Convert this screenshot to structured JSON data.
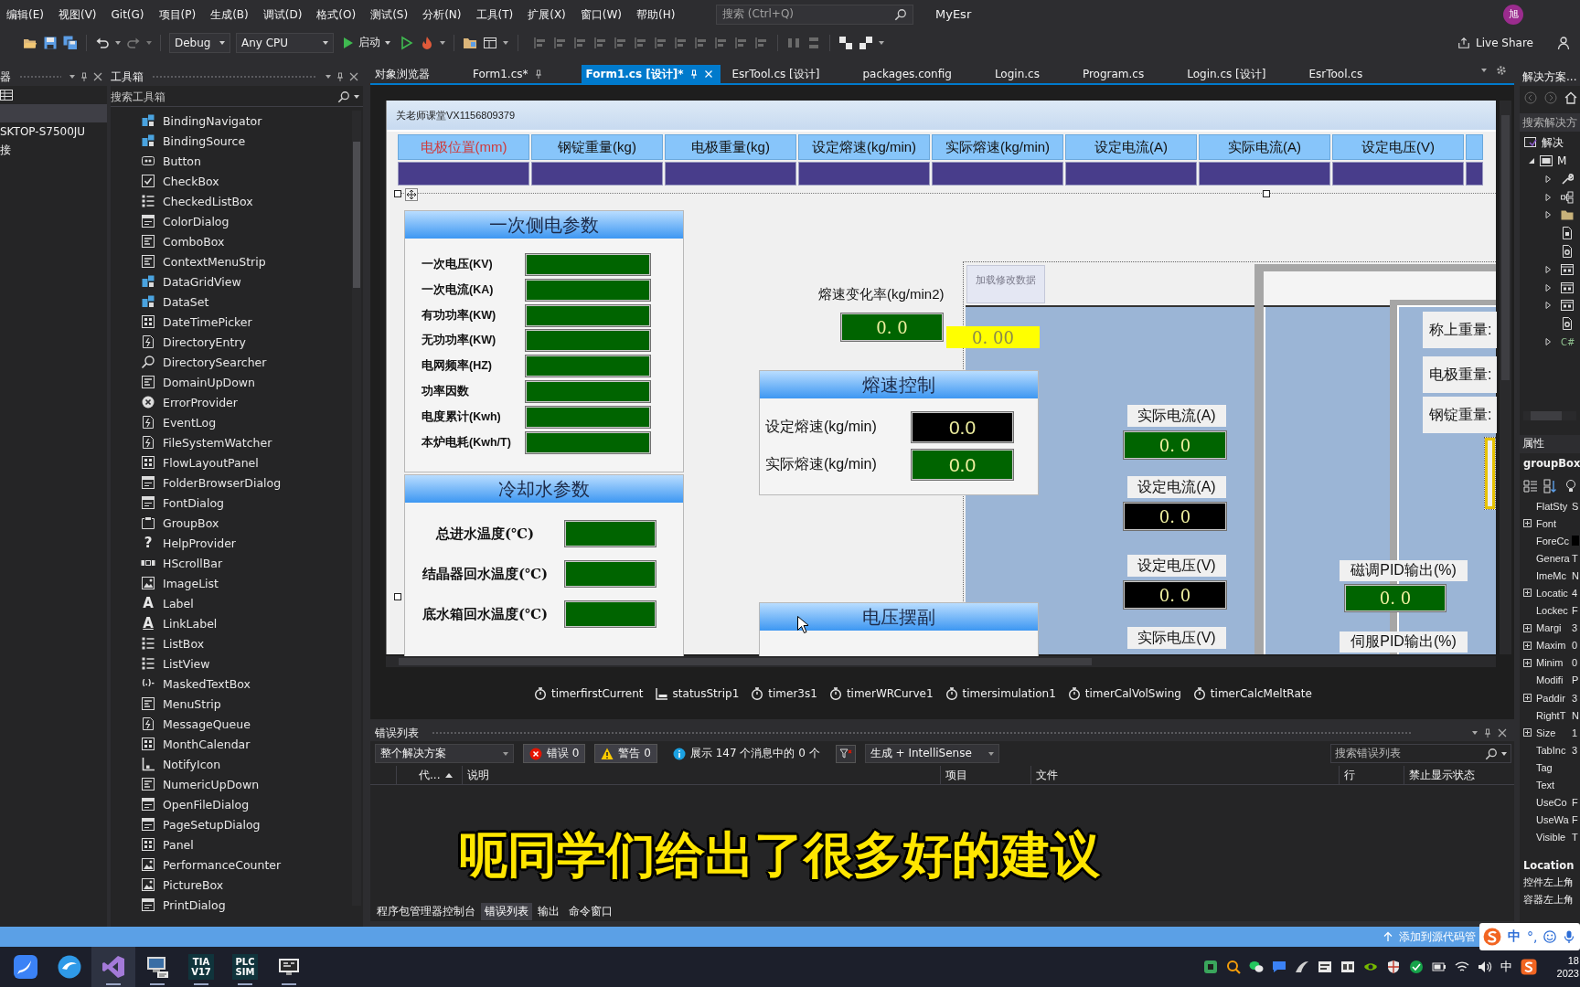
{
  "menu_bar": {
    "items": [
      "编辑(E)",
      "视图(V)",
      "Git(G)",
      "项目(P)",
      "生成(B)",
      "调试(D)",
      "格式(O)",
      "测试(S)",
      "分析(N)",
      "工具(T)",
      "扩展(X)",
      "窗口(W)",
      "帮助(H)"
    ],
    "search": {
      "placeholder": "搜索 (Ctrl+Q)"
    },
    "solution_name": "MyEsr",
    "account_initial": "旭"
  },
  "toolbar": {
    "configuration": "Debug",
    "platform": "Any CPU",
    "start": "启动",
    "live_share": "Live Share"
  },
  "server_explorer": {
    "title": "器",
    "items": [
      {
        "kind": "icon",
        "selected": false
      },
      {
        "kind": "blank",
        "selected": true
      },
      {
        "kind": "text",
        "text": "SKTOP-S7500JU",
        "selected": false
      },
      {
        "kind": "text",
        "text": "接",
        "selected": false
      }
    ]
  },
  "toolbox": {
    "title": "工具箱",
    "search": {
      "placeholder": "搜索工具箱"
    },
    "items": [
      {
        "name": "BindingNavigator",
        "kind": "data"
      },
      {
        "name": "BindingSource",
        "kind": "data"
      },
      {
        "name": "Button",
        "kind": "button"
      },
      {
        "name": "CheckBox",
        "kind": "check"
      },
      {
        "name": "CheckedListBox",
        "kind": "list"
      },
      {
        "name": "ColorDialog",
        "kind": "dialog"
      },
      {
        "name": "ComboBox",
        "kind": "combo"
      },
      {
        "name": "ContextMenuStrip",
        "kind": "combo"
      },
      {
        "name": "DataGridView",
        "kind": "data"
      },
      {
        "name": "DataSet",
        "kind": "data"
      },
      {
        "name": "DateTimePicker",
        "kind": "grid"
      },
      {
        "name": "DirectoryEntry",
        "kind": "log"
      },
      {
        "name": "DirectorySearcher",
        "kind": "search"
      },
      {
        "name": "DomainUpDown",
        "kind": "combo"
      },
      {
        "name": "ErrorProvider",
        "kind": "error"
      },
      {
        "name": "EventLog",
        "kind": "log"
      },
      {
        "name": "FileSystemWatcher",
        "kind": "log"
      },
      {
        "name": "FlowLayoutPanel",
        "kind": "grid"
      },
      {
        "name": "FolderBrowserDialog",
        "kind": "dialog"
      },
      {
        "name": "FontDialog",
        "kind": "dialog"
      },
      {
        "name": "GroupBox",
        "kind": "group"
      },
      {
        "name": "HelpProvider",
        "kind": "glyph",
        "glyph": "?"
      },
      {
        "name": "HScrollBar",
        "kind": "scrollbar"
      },
      {
        "name": "ImageList",
        "kind": "image"
      },
      {
        "name": "Label",
        "kind": "glyph",
        "glyph": "A"
      },
      {
        "name": "LinkLabel",
        "kind": "link_glyph",
        "glyph": "A"
      },
      {
        "name": "ListBox",
        "kind": "list"
      },
      {
        "name": "ListView",
        "kind": "list"
      },
      {
        "name": "MaskedTextBox",
        "kind": "glyph",
        "glyph": "(.)-"
      },
      {
        "name": "MenuStrip",
        "kind": "combo"
      },
      {
        "name": "MessageQueue",
        "kind": "log"
      },
      {
        "name": "MonthCalendar",
        "kind": "grid"
      },
      {
        "name": "NotifyIcon",
        "kind": "notify"
      },
      {
        "name": "NumericUpDown",
        "kind": "combo"
      },
      {
        "name": "OpenFileDialog",
        "kind": "dialog"
      },
      {
        "name": "PageSetupDialog",
        "kind": "dialog"
      },
      {
        "name": "Panel",
        "kind": "grid"
      },
      {
        "name": "PerformanceCounter",
        "kind": "image"
      },
      {
        "name": "PictureBox",
        "kind": "image"
      },
      {
        "name": "PrintDialog",
        "kind": "dialog"
      }
    ]
  },
  "document_tabs": [
    {
      "label": "对象浏览器",
      "selected": false,
      "pinned": false
    },
    {
      "label": "Form1.cs*",
      "selected": false,
      "pinned": true
    },
    {
      "label": "Form1.cs [设计]*",
      "selected": true,
      "pinned": true
    },
    {
      "label": "EsrTool.cs [设计]",
      "selected": false,
      "pinned": false
    },
    {
      "label": "packages.config",
      "selected": false,
      "pinned": false
    },
    {
      "label": "Login.cs",
      "selected": false,
      "pinned": false
    },
    {
      "label": "Program.cs",
      "selected": false,
      "pinned": false
    },
    {
      "label": "Login.cs [设计]",
      "selected": false,
      "pinned": false
    },
    {
      "label": "EsrTool.cs",
      "selected": false,
      "pinned": false
    }
  ],
  "designer": {
    "form": {
      "title": "关老师课堂VX1156809379",
      "grid_columns": [
        {
          "label": "电极位置(mm)",
          "highlighted": true
        },
        {
          "label": "钢锭重量(kg)",
          "highlighted": false
        },
        {
          "label": "电极重量(kg)",
          "highlighted": false
        },
        {
          "label": "设定熔速(kg/min)",
          "highlighted": false
        },
        {
          "label": "实际熔速(kg/min)",
          "highlighted": false
        },
        {
          "label": "设定电流(A)",
          "highlighted": false
        },
        {
          "label": "实际电流(A)",
          "highlighted": false
        },
        {
          "label": "设定电压(V)",
          "highlighted": false
        }
      ],
      "groups": [
        {
          "title": "一次侧电参数",
          "kind": "compact",
          "rows": [
            "一次电压(KV)",
            "一次电流(KA)",
            "有功功率(KW)",
            "无功功率(KW)",
            "电网频率(HZ)",
            "功率因数",
            "电度累计(Kwh)",
            "本炉电耗(Kwh/T)"
          ]
        },
        {
          "title": "冷却水参数",
          "kind": "spaced",
          "rows": [
            "总进水温度(℃)",
            "结晶器回水温度(℃)",
            "底水箱回水温度(℃)"
          ]
        }
      ],
      "melt_rate_change": {
        "label": "熔速变化率(kg/min2)",
        "value": "0. 0",
        "trend_value": "0. 00"
      },
      "load_button": "加载修改数据",
      "melt_control": {
        "title": "熔速控制",
        "rows": [
          {
            "label": "设定熔速(kg/min)",
            "value": "0.0",
            "kind": "setpoint"
          },
          {
            "label": "实际熔速(kg/min)",
            "value": "0.0",
            "kind": "actual"
          }
        ]
      },
      "voltage_swing": {
        "title": "电压摆副"
      },
      "readouts": [
        {
          "label": "实际电流(A)",
          "value": "0. 0",
          "kind": "actual"
        },
        {
          "label": "设定电流(A)",
          "value": "0. 0",
          "kind": "setpoint"
        },
        {
          "label": "设定电压(V)",
          "value": "0. 0",
          "kind": "setpoint"
        },
        {
          "label": "实际电压(V)"
        }
      ],
      "pid_outputs": [
        {
          "label": "磁调PID输出(%)",
          "value": "0. 0"
        },
        {
          "label": "伺服PID输出(%)"
        }
      ],
      "weights": [
        "称上重量:",
        "电极重量:",
        "钢锭重量:"
      ]
    },
    "components": [
      {
        "name": "timerfirstCurrent",
        "kind": "timer"
      },
      {
        "name": "statusStrip1",
        "kind": "status_strip"
      },
      {
        "name": "timer3s1",
        "kind": "timer"
      },
      {
        "name": "timerWRCurve1",
        "kind": "timer"
      },
      {
        "name": "timersimulation1",
        "kind": "timer"
      },
      {
        "name": "timerCalVolSwing",
        "kind": "timer"
      },
      {
        "name": "timerCalcMeltRate",
        "kind": "timer"
      }
    ]
  },
  "error_list": {
    "title": "错误列表",
    "scope": "整个解决方案",
    "filters": [
      {
        "kind": "error",
        "label": "错误 0",
        "selected": true
      },
      {
        "kind": "warning",
        "label": "警告 0",
        "selected": true
      },
      {
        "kind": "info",
        "label": "展示 147 个消息中的 0 个",
        "selected": false
      }
    ],
    "build_filter": "生成 + IntelliSense",
    "search": {
      "placeholder": "搜索错误列表"
    },
    "columns": [
      "代...",
      "说明",
      "项目",
      "文件",
      "行",
      "禁止显示状态"
    ]
  },
  "bottom_tabs": [
    {
      "label": "程序包管理器控制台",
      "selected": false
    },
    {
      "label": "错误列表",
      "selected": true
    },
    {
      "label": "输出",
      "selected": false
    },
    {
      "label": "命令窗口",
      "selected": false
    }
  ],
  "subtitle": "呃同学们给出了很多好的建议",
  "solution_explorer": {
    "title": "解决方案...",
    "search": {
      "placeholder": "搜索解决方"
    },
    "solution": "解决",
    "project": {
      "name": "M",
      "expanded": true
    },
    "items": [
      {
        "kind": "wrench",
        "expandable": true
      },
      {
        "kind": "references",
        "expandable": true
      },
      {
        "kind": "folder",
        "expandable": true
      },
      {
        "kind": "file",
        "expandable": false
      },
      {
        "kind": "settings_file",
        "expandable": false
      },
      {
        "kind": "form",
        "expandable": true
      },
      {
        "kind": "form",
        "expandable": true
      },
      {
        "kind": "form",
        "expandable": true
      },
      {
        "kind": "settings_file",
        "expandable": false
      },
      {
        "kind": "glyph",
        "glyph": "C#",
        "expandable": true
      }
    ]
  },
  "properties": {
    "title": "属性",
    "object": "groupBox",
    "rows": [
      {
        "name": "FlatSty",
        "value": "S",
        "expandable": false
      },
      {
        "name": "Font",
        "expandable": true
      },
      {
        "name": "ForeCc",
        "color": "#000000",
        "expandable": false
      },
      {
        "name": "Genera",
        "value": "T",
        "expandable": false
      },
      {
        "name": "ImeMc",
        "value": "N",
        "expandable": false
      },
      {
        "name": "Locatic",
        "value": "4",
        "expandable": true
      },
      {
        "name": "Lockec",
        "value": "F",
        "expandable": false
      },
      {
        "name": "Margi",
        "value": "3",
        "expandable": true
      },
      {
        "name": "Maxim",
        "value": "0",
        "expandable": true
      },
      {
        "name": "Minim",
        "value": "0",
        "expandable": true
      },
      {
        "name": "Modifi",
        "value": "P",
        "expandable": false
      },
      {
        "name": "Paddir",
        "value": "3",
        "expandable": true
      },
      {
        "name": "RightT",
        "value": "N",
        "expandable": false
      },
      {
        "name": "Size",
        "value": "1",
        "expandable": true
      },
      {
        "name": "TabInc",
        "value": "3",
        "expandable": false
      },
      {
        "name": "Tag",
        "expandable": false
      },
      {
        "name": "Text",
        "expandable": false
      },
      {
        "name": "UseCo",
        "value": "F",
        "expandable": false
      },
      {
        "name": "UseWa",
        "value": "F",
        "expandable": false
      },
      {
        "name": "Visible",
        "value": "T",
        "expandable": false
      }
    ],
    "description_title": "Location",
    "description": [
      "控件左上角",
      "容器左上角"
    ]
  },
  "status_bar": {
    "text": "添加到源代码管"
  },
  "ime_bar": {
    "mode": "中",
    "punctuation": "°,"
  },
  "taskbar": {
    "apps": [
      {
        "kind": "bird",
        "running": false,
        "selected": false
      },
      {
        "kind": "circle",
        "running": false,
        "selected": false
      },
      {
        "kind": "vs",
        "running": true,
        "selected": true
      },
      {
        "kind": "computer",
        "running": true,
        "selected": false
      },
      {
        "kind": "tile",
        "lines": [
          "TIA",
          "V17"
        ],
        "running": true,
        "selected": false
      },
      {
        "kind": "tile",
        "lines": [
          "PLC",
          "SIM"
        ],
        "running": true,
        "selected": false
      },
      {
        "kind": "screen",
        "running": true,
        "selected": false
      }
    ],
    "input_mode": "中",
    "clock": {
      "time": "18",
      "date": "2023"
    }
  }
}
